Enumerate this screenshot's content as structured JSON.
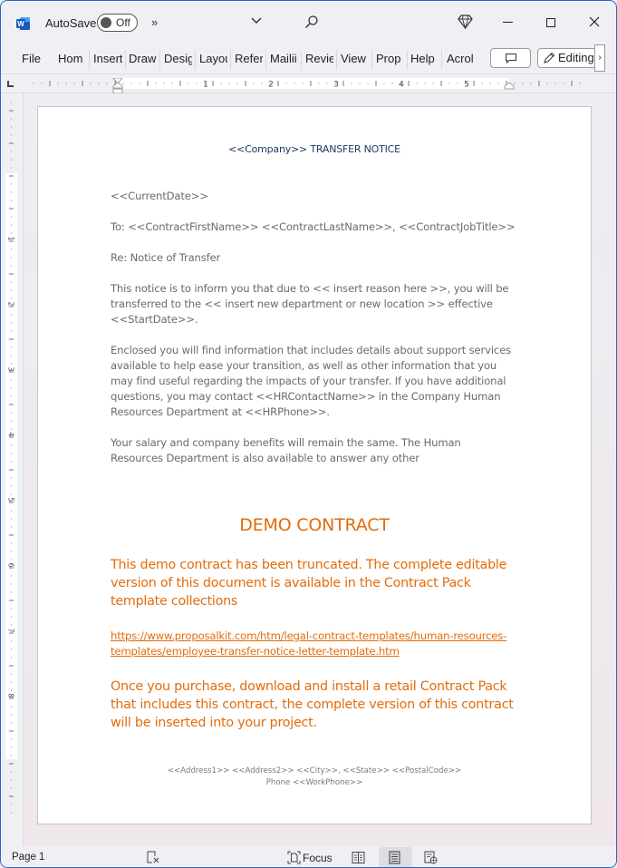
{
  "titlebar": {
    "autosave_label": "AutoSave",
    "autosave_state": "Off",
    "more_commands": "»"
  },
  "ribbon": {
    "tabs": [
      "File",
      "Home",
      "Insert",
      "Draw",
      "Design",
      "Layout",
      "References",
      "Mailings",
      "Review",
      "View",
      "Properties",
      "Help",
      "Acrobat"
    ],
    "tabs_visible": [
      "File",
      "Hom",
      "Insert",
      "Draw",
      "Desig",
      "Layou",
      "Refer",
      "Mailii",
      "Revie",
      "View",
      "Prop",
      "Help",
      "Acrol"
    ],
    "editing_label": "Editing",
    "more_label": "›"
  },
  "ruler": {
    "h_labels": [
      "1",
      "2",
      "3",
      "4",
      "5"
    ],
    "v_labels": [
      "1",
      "2",
      "3",
      "4",
      "5",
      "6",
      "7",
      "8"
    ]
  },
  "document": {
    "title": "<<Company>> TRANSFER NOTICE",
    "paragraphs": [
      "<<CurrentDate>>",
      "To: <<ContractFirstName>> <<ContractLastName>>, <<ContractJobTitle>>",
      "Re: Notice of Transfer",
      "This notice is to inform you that due to << insert reason here >>, you will be transferred to the << insert new department or new location >> effective <<StartDate>>.",
      "Enclosed you will find information that includes details about support services available to help ease your transition, as well as other information that you may find useful regarding the impacts of your transfer. If you have additional questions, you may contact <<HRContactName>> in the Company Human Resources Department at <<HRPhone>>.",
      "Your salary and company benefits will remain the same. The Human Resources Department is also available to answer any other"
    ],
    "demo_heading": "DEMO CONTRACT",
    "demo_notice": "This demo contract has been truncated. The complete editable version of this document is available in the Contract Pack template collections",
    "demo_link": "https://www.proposalkit.com/htm/legal-contract-templates/human-resources-templates/employee-transfer-notice-letter-template.htm",
    "demo_purchase": "Once you purchase, download and install a retail Contract Pack that includes this contract, the complete version of this contract will be inserted into your project.",
    "footer_line1": "<<Address1>> <<Address2>> <<City>>, <<State>> <<PostalCode>>",
    "footer_line2": "Phone <<WorkPhone>>"
  },
  "statusbar": {
    "page": "Page 1",
    "focus_label": "Focus"
  },
  "colors": {
    "accent_orange": "#e36c0a",
    "title_navy": "#1f3864",
    "word_blue": "#185abd"
  }
}
